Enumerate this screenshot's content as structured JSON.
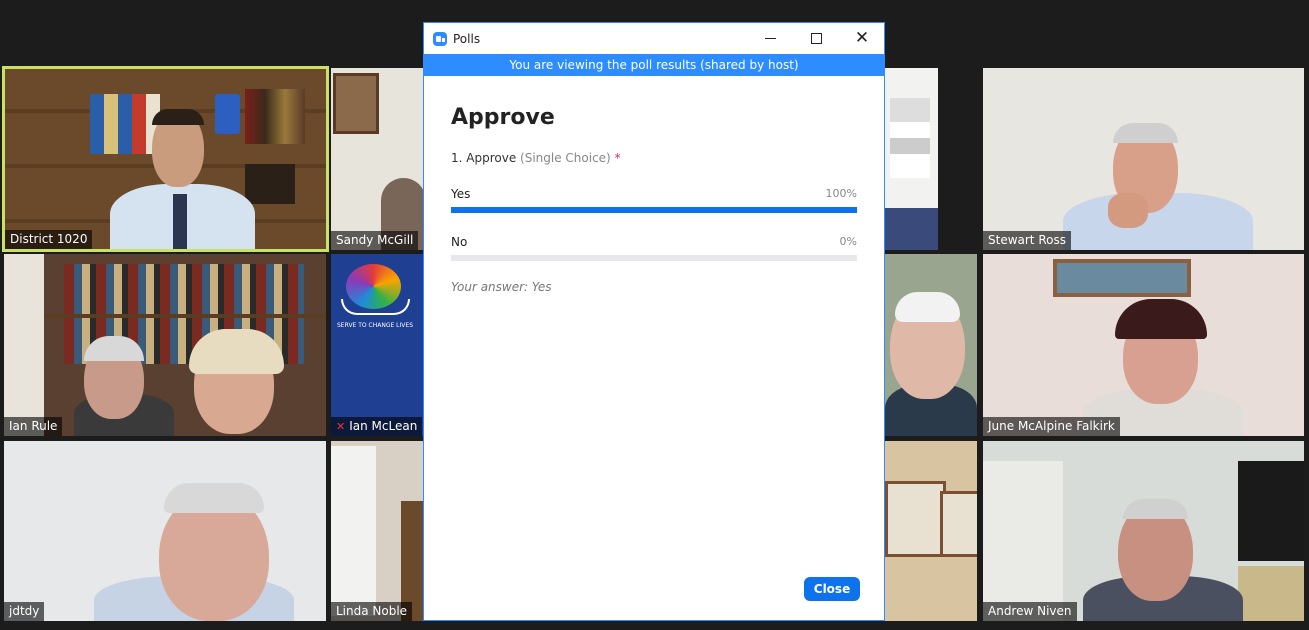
{
  "participants": [
    {
      "name": "District 1020",
      "active": true
    },
    {
      "name": "Sandy McGill"
    },
    {
      "name": "Stewart Ross"
    },
    {
      "name": "Ian Rule"
    },
    {
      "name": "Ian McLean",
      "muted": true
    },
    {
      "name": "June McAlpine Falkirk"
    },
    {
      "name": "jdtdy"
    },
    {
      "name": "Linda Noble"
    },
    {
      "name": "Andrew Niven"
    }
  ],
  "rotary_logo_text": "SERVE TO CHANGE LIVES",
  "poll_window": {
    "title": "Polls",
    "banner": "You are viewing the poll results (shared by host)",
    "poll_title": "Approve",
    "question": {
      "text": "1. Approve",
      "type": "(Single Choice)",
      "required_mark": "*"
    },
    "options": [
      {
        "label": "Yes",
        "percent_text": "100%",
        "percent": 100
      },
      {
        "label": "No",
        "percent_text": "0%",
        "percent": 0
      }
    ],
    "your_answer": "Your answer: Yes",
    "close_label": "Close"
  },
  "colors": {
    "accent": "#0e72ed",
    "banner": "#2d8cff",
    "active_speaker": "#c9e265"
  }
}
